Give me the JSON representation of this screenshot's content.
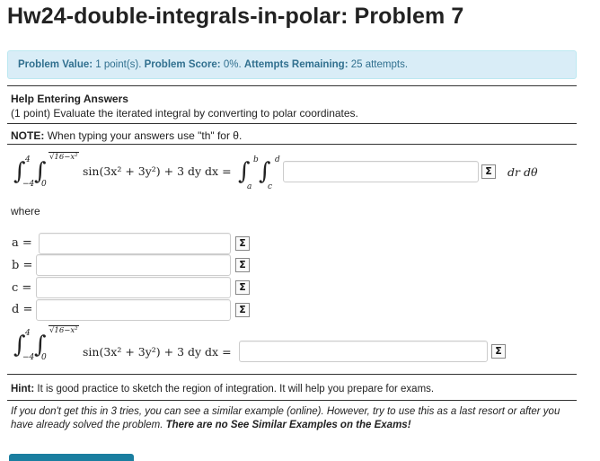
{
  "page": {
    "title": "Hw24-double-integrals-in-polar: Problem 7"
  },
  "info": {
    "problem_value_label": "Problem Value:",
    "problem_value": "1 point(s).",
    "problem_score_label": "Problem Score:",
    "problem_score": "0%.",
    "attempts_label": "Attempts Remaining:",
    "attempts": "25 attempts."
  },
  "problem": {
    "help_link": "Help Entering Answers",
    "statement": "(1 point) Evaluate the iterated integral by converting to polar coordinates.",
    "note_label": "NOTE:",
    "note_text": "When typing your answers use \"th\" for θ.",
    "where": "where",
    "integral1": {
      "outer_upper": "4",
      "outer_lower": "−4",
      "inner_upper": "√16−x²",
      "inner_lower": "0",
      "integrand": "sin(3x² + 3y²) + 3 dy dx =",
      "polar_outer_upper": "b",
      "polar_outer_lower": "a",
      "polar_inner_upper": "d",
      "polar_inner_lower": "c",
      "answer_value": "",
      "suffix": "dr dθ"
    },
    "vars": [
      {
        "label": "a =",
        "value": ""
      },
      {
        "label": "b =",
        "value": ""
      },
      {
        "label": "c =",
        "value": ""
      },
      {
        "label": "d =",
        "value": ""
      }
    ],
    "integral2": {
      "outer_upper": "4",
      "outer_lower": "−4",
      "inner_upper": "√16−x²",
      "inner_lower": "0",
      "integrand": "sin(3x² + 3y²) + 3 dy dx =",
      "answer_value": ""
    },
    "sigma_glyph": "Σ",
    "hint_label": "Hint:",
    "hint_text": "It is good practice to sketch the region of integration. It will help you prepare for exams.",
    "online_note": "If you don't get this in 3 tries, you can see a similar example (online). However, try to use this as a last resort or after you have already solved the problem.",
    "online_note_bold": "There are no See Similar Examples on the Exams!"
  },
  "colors": {
    "info_bg": "#d9edf7",
    "info_text": "#31708f",
    "submit_button": "#1a7ea0"
  }
}
